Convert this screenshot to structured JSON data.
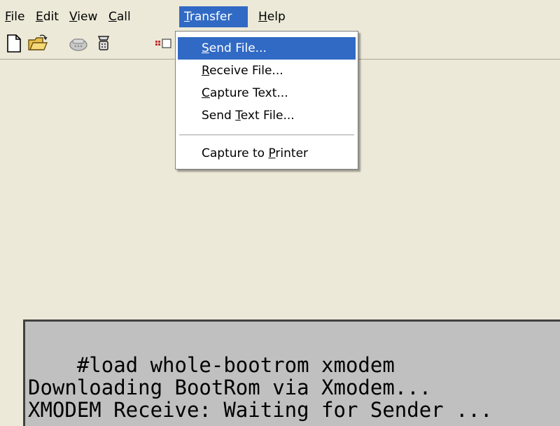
{
  "menubar": {
    "items": [
      {
        "label_u": "F",
        "label_rest": "ile"
      },
      {
        "label_u": "E",
        "label_rest": "dit"
      },
      {
        "label_u": "V",
        "label_rest": "iew"
      },
      {
        "label_u": "C",
        "label_rest": "all"
      },
      {
        "label_u": "T",
        "label_rest": "ransfer"
      },
      {
        "label_u": "H",
        "label_rest": "elp"
      }
    ]
  },
  "toolbar": {
    "icons": [
      "new-file-icon",
      "open-folder-icon",
      "disconnect-phone-icon",
      "connect-phone-icon",
      "properties-icon"
    ]
  },
  "transfer_menu": {
    "items": [
      {
        "pre": "",
        "u": "S",
        "post": "end File...",
        "highlighted": true
      },
      {
        "pre": "",
        "u": "R",
        "post": "eceive File...",
        "highlighted": false
      },
      {
        "pre": "",
        "u": "C",
        "post": "apture Text...",
        "highlighted": false
      },
      {
        "pre": "Send ",
        "u": "T",
        "post": "ext File...",
        "highlighted": false
      },
      {
        "pre": "Capture to ",
        "u": "P",
        "post": "rinter",
        "highlighted": false
      }
    ]
  },
  "terminal": {
    "lines": [
      "    #load whole-bootrom xmodem",
      "Downloading BootRom via Xmodem...",
      "XMODEM Receive: Waiting for Sender ..."
    ]
  },
  "colors": {
    "menu_highlight": "#316ac5",
    "window_bg": "#ece9d8",
    "terminal_bg": "#c0c0c0"
  }
}
